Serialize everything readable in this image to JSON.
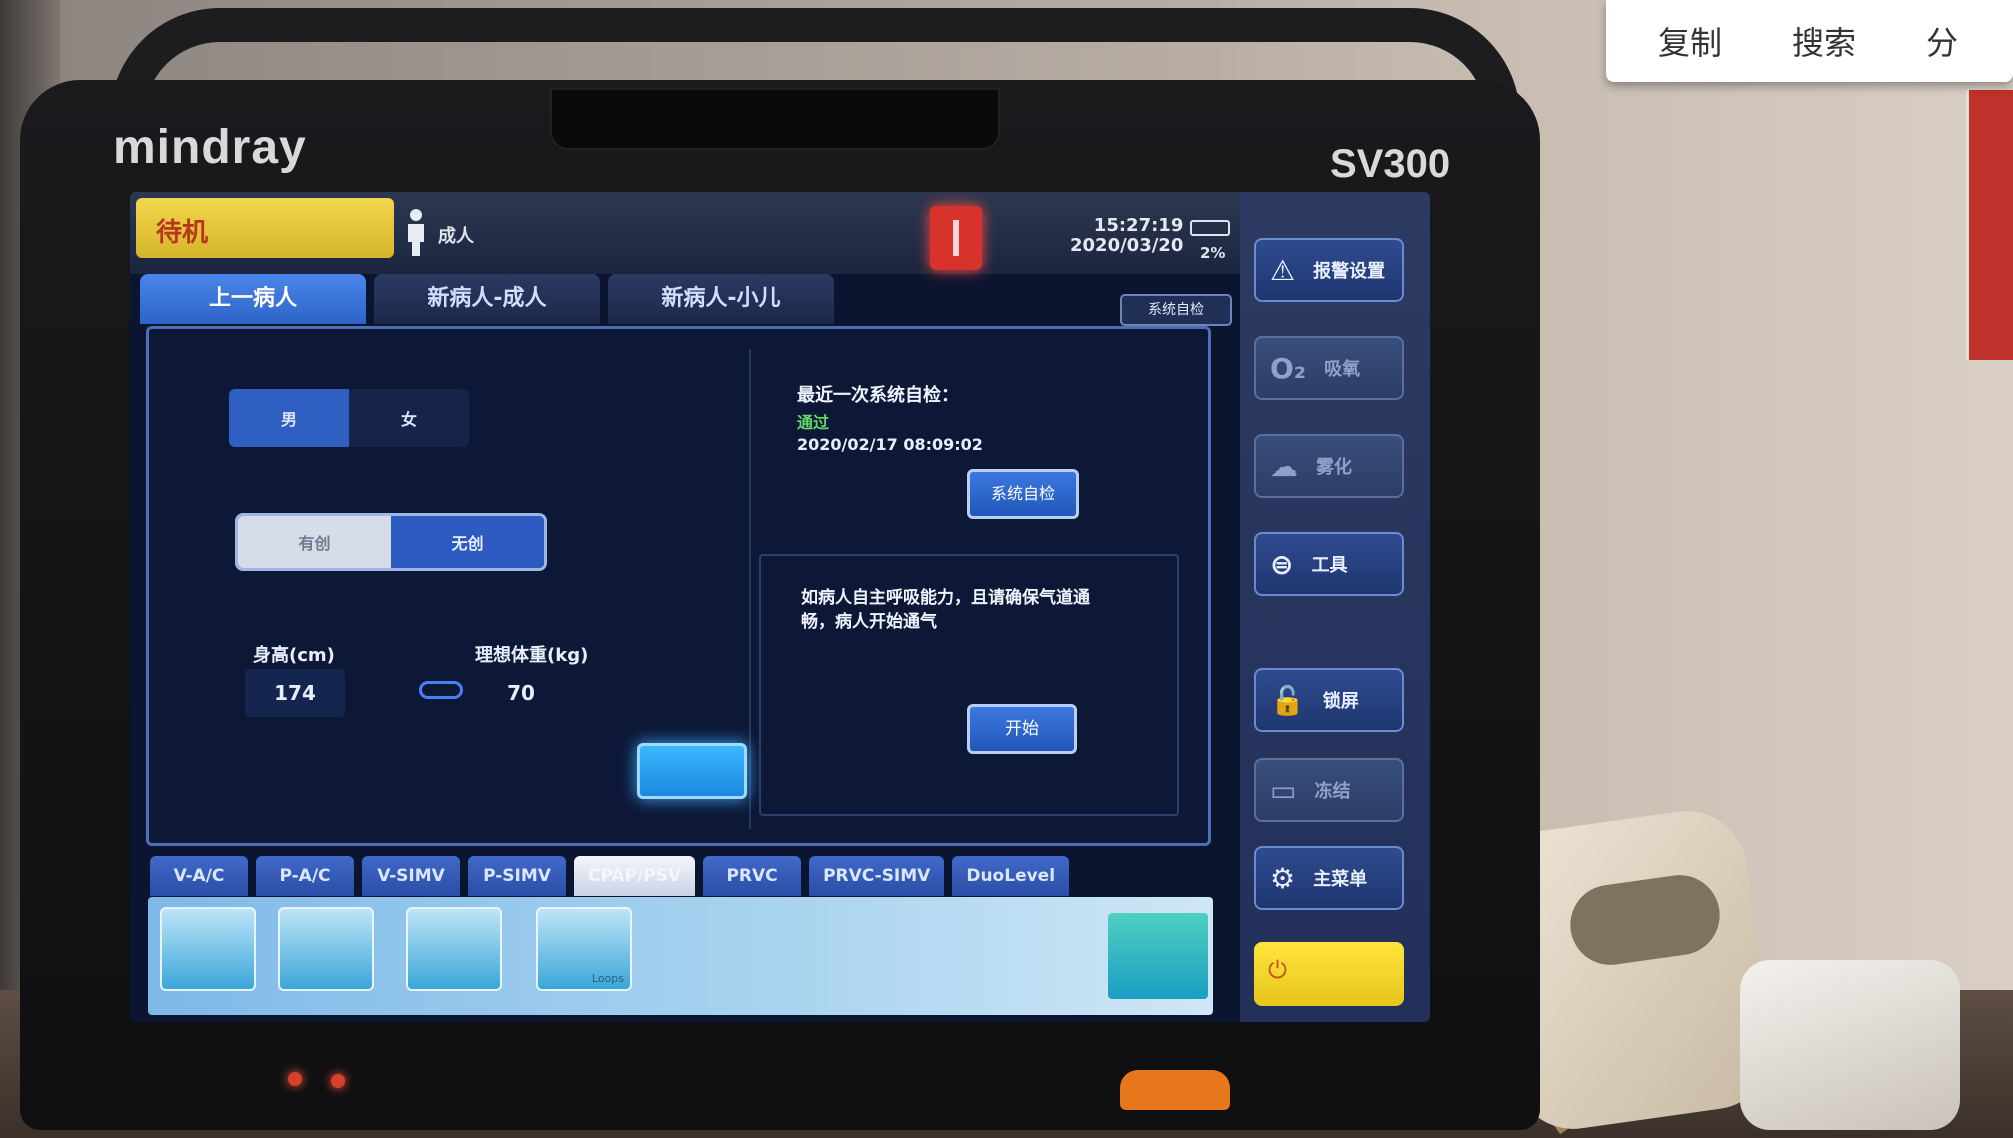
{
  "device": {
    "brand": "mindray",
    "model": "SV300"
  },
  "status": {
    "mode": "待机",
    "patient_type": "成人",
    "time": "15:27:19",
    "date": "2020/03/20",
    "battery": "2%"
  },
  "tabs": [
    {
      "label": "上一病人",
      "active": true
    },
    {
      "label": "新病人-成人",
      "active": false
    },
    {
      "label": "新病人-小儿",
      "active": false
    }
  ],
  "tab_right_button": "系统自检",
  "patient": {
    "gender": {
      "male": "男",
      "female": "女"
    },
    "humidification": {
      "option_a": "有创",
      "option_b": "无创"
    },
    "height_label": "身高(cm)",
    "height_value": "174",
    "weight_label": "理想体重(kg)",
    "weight_value": "70"
  },
  "self_check": {
    "title": "最近一次系统自检：",
    "result": "通过",
    "date": "2020/02/17 08:09:02",
    "button": "系统自检"
  },
  "standby": {
    "message": "如病人自主呼吸能力，且请确保气道通畅，病人开始通气",
    "button": "开始"
  },
  "mode_tabs": [
    "V-A/C",
    "P-A/C",
    "V-SIMV",
    "P-SIMV",
    "CPAP/PSV",
    "PRVC",
    "PRVC-SIMV",
    "DuoLevel"
  ],
  "mode_tiles": [
    "",
    "",
    "",
    "Loops"
  ],
  "sidebar": [
    {
      "icon": "alarm-limit-icon",
      "glyph": "⚠",
      "label": "报警设置"
    },
    {
      "icon": "oxygen-icon",
      "glyph": "O₂",
      "label": "吸氧"
    },
    {
      "icon": "nebulizer-icon",
      "glyph": "☁",
      "label": "雾化"
    },
    {
      "icon": "tools-icon",
      "glyph": "⊜",
      "label": "工具"
    },
    {
      "icon": "lock-icon",
      "glyph": "🔓",
      "label": "锁屏"
    },
    {
      "icon": "freeze-icon",
      "glyph": "▭",
      "label": "冻结"
    },
    {
      "icon": "gear-icon",
      "glyph": "⚙",
      "label": "主菜单"
    }
  ],
  "power_glyph": "⏻",
  "context_menu": [
    "复制",
    "搜索",
    "分"
  ],
  "colors": {
    "standby_yellow": "#f2d64a",
    "alarm_red": "#d8322d",
    "accent_blue": "#2f5fc2",
    "pass_green": "#63d86a"
  }
}
